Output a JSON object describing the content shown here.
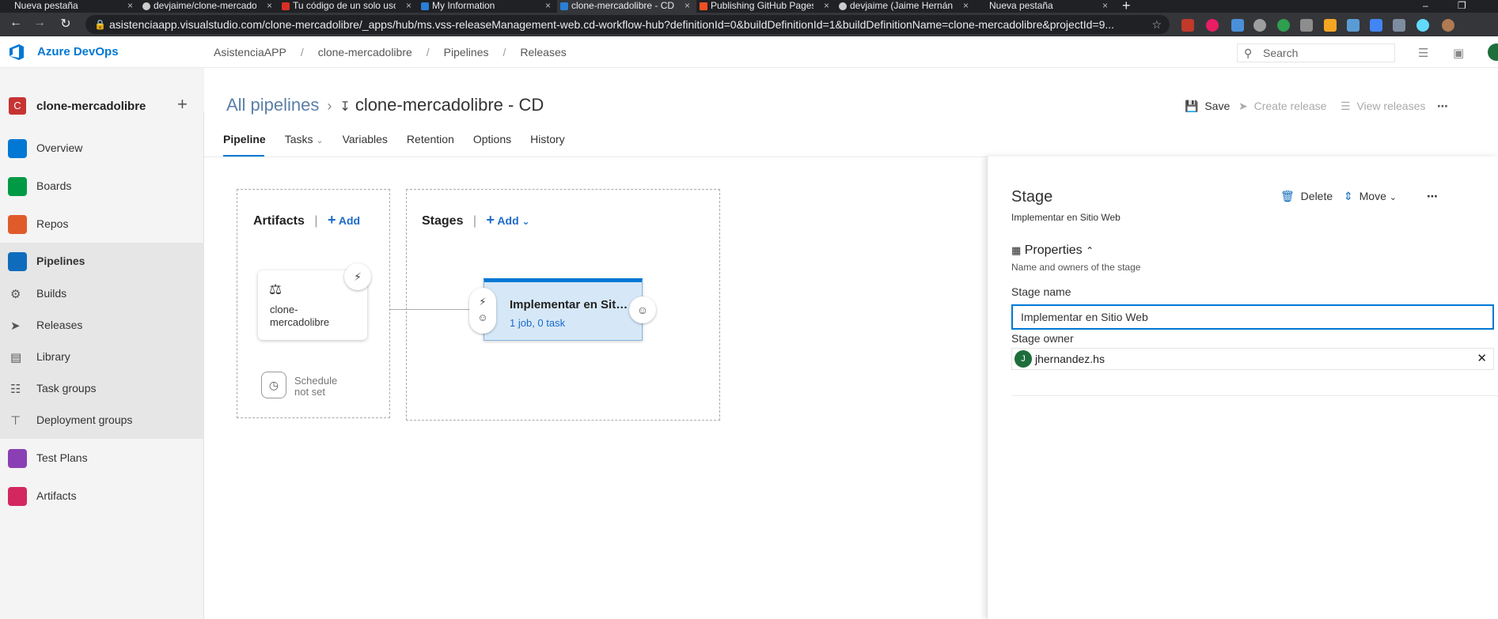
{
  "browser": {
    "tabs": [
      {
        "title": "Nueva pestaña",
        "active": false
      },
      {
        "title": "devjaime/clone-mercadolib",
        "active": false
      },
      {
        "title": "Tu código de un solo uso -",
        "active": false
      },
      {
        "title": "My Information",
        "active": false
      },
      {
        "title": "clone-mercadolibre - CD - ",
        "active": true
      },
      {
        "title": "Publishing GitHub Pages fr",
        "active": false
      },
      {
        "title": "devjaime (Jaime Hernández",
        "active": false
      },
      {
        "title": "Nueva pestaña",
        "active": false
      }
    ],
    "close_glyph": "×",
    "new_tab_glyph": "+",
    "url": "asistenciaapp.visualstudio.com/clone-mercadolibre/_apps/hub/ms.vss-releaseManagement-web.cd-workflow-hub?definitionId=0&buildDefinitionId=1&buildDefinitionName=clone-mercadolibre&projectId=9..."
  },
  "header": {
    "product": "Azure DevOps",
    "breadcrumbs": [
      "AsistenciaAPP",
      "clone-mercadolibre",
      "Pipelines",
      "Releases"
    ],
    "separator": "/",
    "search_placeholder": "Search"
  },
  "sidebar": {
    "project_badge": "C",
    "project_name": "clone-mercadolibre",
    "add_glyph": "+",
    "items": [
      {
        "label": "Overview",
        "color": "#0078d4"
      },
      {
        "label": "Boards",
        "color": "#009a44"
      },
      {
        "label": "Repos",
        "color": "#e05b2a"
      },
      {
        "label": "Pipelines",
        "color": "#0f6cbd"
      },
      {
        "label": "Test Plans",
        "color": "#8a3fb5"
      },
      {
        "label": "Artifacts",
        "color": "#d2285f"
      }
    ],
    "pipeline_subitems": [
      {
        "label": "Builds",
        "icon": "build-icon"
      },
      {
        "label": "Releases",
        "icon": "rocket-icon"
      },
      {
        "label": "Library",
        "icon": "library-icon"
      },
      {
        "label": "Task groups",
        "icon": "task-group-icon"
      },
      {
        "label": "Deployment groups",
        "icon": "deployment-group-icon"
      }
    ]
  },
  "main": {
    "breadcrumb_link": "All pipelines",
    "pipeline_title": "clone-mercadolibre - CD",
    "actions": {
      "save": "Save",
      "create_release": "Create release",
      "view_releases": "View releases"
    },
    "tabs": [
      "Pipeline",
      "Tasks",
      "Variables",
      "Retention",
      "Options",
      "History"
    ],
    "active_tab": "Pipeline",
    "artifacts": {
      "heading": "Artifacts",
      "add": "Add",
      "artifact_name": "clone-\nmercadolibre",
      "schedule_line1": "Schedule",
      "schedule_line2": "not set"
    },
    "stages": {
      "heading": "Stages",
      "add": "Add",
      "stage_name": "Implementar en Sitio Web",
      "stage_meta": "1 job, 0 task"
    }
  },
  "panel": {
    "title": "Stage",
    "subtitle": "Implementar en Sitio Web",
    "delete": "Delete",
    "move": "Move",
    "section_title": "Properties",
    "section_subtitle": "Name and owners of the stage",
    "stage_name_label": "Stage name",
    "stage_name_value": "Implementar en Sitio Web",
    "stage_owner_label": "Stage owner",
    "owner_initial": "J",
    "owner_name": "jhernandez.hs"
  },
  "colors": {
    "accent": "#0078d4",
    "stage_fill": "#d6e8f7",
    "project_badge": "#c73333",
    "owner_avatar": "#1e6e3c"
  }
}
